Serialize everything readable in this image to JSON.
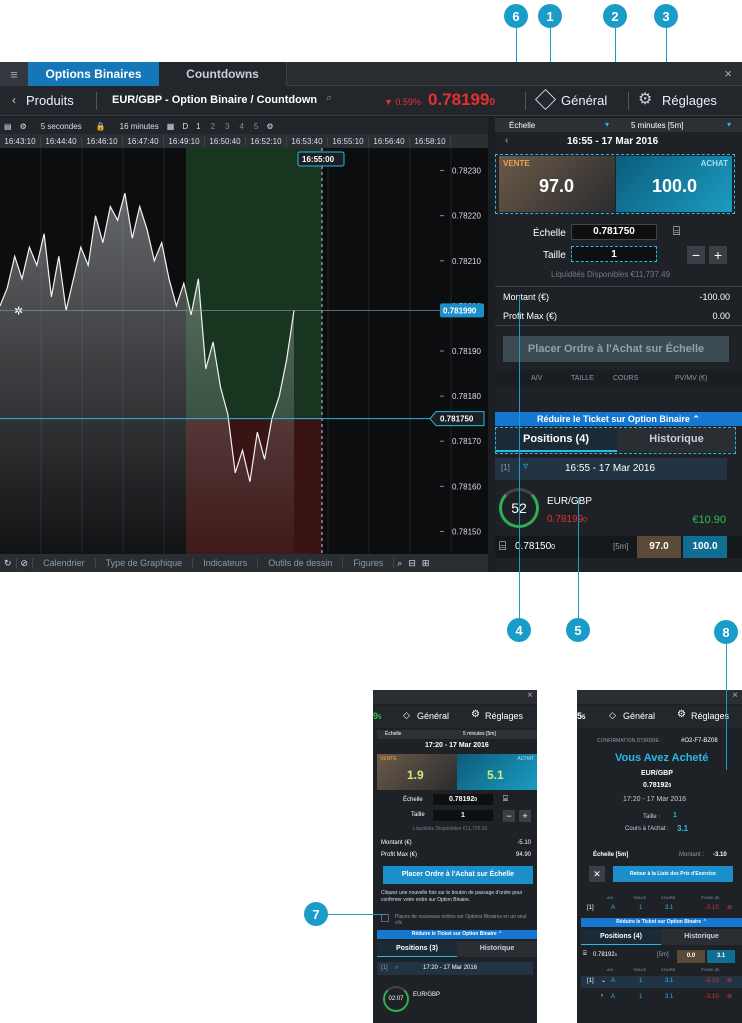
{
  "callouts": [
    "1",
    "2",
    "3",
    "4",
    "5",
    "6",
    "7",
    "8"
  ],
  "menu_tabs": [
    "Options Binaires",
    "Countdowns"
  ],
  "close_glyph": "×",
  "subbar": {
    "back_label": "Produits",
    "instrument": "EUR/GBP - Option Binaire / Countdown",
    "change": "▼ 0.59%",
    "price_main": "0.78199",
    "price_sub": "0",
    "general": "Général",
    "settings": "Réglages"
  },
  "chart_toolbar": {
    "interval": "5 secondes",
    "range": "16 minutes",
    "d": "D",
    "pages": [
      "1",
      "2",
      "3",
      "4",
      "5"
    ]
  },
  "time_ticks": [
    "16:43:10",
    "16:44:40",
    "16:46:10",
    "16:47:40",
    "16:49:10",
    "16:50:40",
    "16:52:10",
    "16:53:40",
    "16:55:10",
    "16:56:40",
    "16:58:10"
  ],
  "chart_data": {
    "type": "line",
    "y_ticks": [
      "0.78230",
      "0.78220",
      "0.78210",
      "0.78200",
      "0.78190",
      "0.78180",
      "0.78170",
      "0.78160",
      "0.78150"
    ],
    "ylim": [
      0.78145,
      0.78235
    ],
    "current_price_label": "0.781990",
    "strike_label": "0.781750",
    "expiry_label": "16:55:00",
    "series": [
      {
        "values": [
          0.782,
          0.78204,
          0.78211,
          0.78206,
          0.78213,
          0.78209,
          0.78216,
          0.78202,
          0.78211,
          0.78199,
          0.78206,
          0.78213,
          0.78209,
          0.7822,
          0.78214,
          0.78222,
          0.78219,
          0.78225,
          0.78215,
          0.78222,
          0.78217,
          0.7821,
          0.78214,
          0.78206,
          0.782,
          0.78205,
          0.78198,
          0.78206,
          0.78186,
          0.78192,
          0.78182,
          0.78176,
          0.78163,
          0.78168,
          0.78161,
          0.78172,
          0.78166,
          0.78175,
          0.7818,
          0.78188,
          0.78199
        ]
      }
    ]
  },
  "bottom_tools": [
    "Calendrier",
    "Type de Graphique",
    "Indicateurs",
    "Outils de dessin",
    "Figures"
  ],
  "ticket": {
    "echelle_label": "Échelle",
    "period": "5 minutes [5m]",
    "expiry": "16:55 - 17 Mar 2016",
    "vente_label": "VENTE",
    "achat_label": "ACHAT",
    "vente_price": "97.0",
    "achat_price": "100.0",
    "echelle_field_label": "Échelle",
    "echelle_value": "0.781750",
    "taille_label": "Taille",
    "taille_value": "1",
    "liquidity": "Liquidités Disponibles €11,737.49",
    "montant_label": "Montant (€)",
    "montant_value": "-100.00",
    "profit_label": "Profit Max (€)",
    "profit_value": "0.00",
    "place_button": "Placer Ordre à l'Achat sur Échelle",
    "cols": [
      "A/V",
      "TAILLE",
      "COURS",
      "PV/MV (€)"
    ],
    "reduce": "Réduire le Ticket sur Option Binaire",
    "positions_tab": "Positions (4)",
    "history_tab": "Historique",
    "pos_index": "[1]",
    "pos_expiry": "16:55 - 17 Mar 2016",
    "countdown": "52",
    "pos_pair": "EUR/GBP",
    "pos_price_main": "0.78199",
    "pos_price_sub": "0",
    "pos_pnl": "€10.90",
    "pos_strike_main": "0.78150",
    "pos_strike_sub": "0",
    "pos_period": "[5m]",
    "pos_sell": "97.0",
    "pos_buy": "100.0"
  },
  "mini1": {
    "top_code": "9",
    "top_sub": "5",
    "general": "Général",
    "settings": "Réglages",
    "echelle": "Échelle",
    "period": "5 minutes [5m]",
    "expiry": "17:20 - 17 Mar 2016",
    "vente_label": "VENTE",
    "achat_label": "ACHAT",
    "vente": "1.9",
    "achat": "5.1",
    "echelle_value_main": "0.78192",
    "echelle_value_sub": "0",
    "taille_label": "Taille",
    "taille": "1",
    "liquidity": "Liquidités Disponibles €11,725.91",
    "montant_label": "Montant (€)",
    "montant": "-5.10",
    "profit_label": "Profit Max (€)",
    "profit": "94.90",
    "place_button": "Placer Ordre à l'Achat sur Échelle",
    "hint": "Cliquez une nouvelle fois sur le bouton de passage d'ordre pour confirmer votre ordre sur Option Binaire.",
    "checkbox_label": "Placez de nouveaux ordres sur Options Binaires en un seul clic",
    "reduce": "Réduire le Ticket sur Option Binaire",
    "positions_tab": "Positions (3)",
    "history_tab": "Historique",
    "pos_index": "[1]",
    "pos_expiry": "17:20 - 17 Mar 2016",
    "countdown": "02:07",
    "pos_pair": "EUR/GBP"
  },
  "mini2": {
    "top_code": "5",
    "top_sub": "5",
    "general": "Général",
    "settings": "Réglages",
    "confirm_label": "CONFIRMATION D'ORDRE :",
    "confirm_code": "#O2-F7-BZ08",
    "bought": "Vous Avez Acheté",
    "pair": "EUR/GBP",
    "price_main": "0.78192",
    "price_sub": "0",
    "expiry": "17:20 - 17 Mar 2016",
    "taille_label": "Taille :",
    "taille": "1",
    "cours_label": "Cours à l'Achat :",
    "cours": "3.1",
    "echelle_label": "Échelle [5m]",
    "montant_label": "Montant :",
    "montant": "-3.10",
    "return_button": "Retour à la Liste des Prix d'Exercice",
    "cols": [
      "A/V",
      "TAILLE",
      "COURS",
      "PV/MV (€)"
    ],
    "row": [
      "[1]",
      "A",
      "1",
      "3.1",
      "-3.10"
    ],
    "reduce": "Réduire le Ticket sur Option Binaire",
    "positions_tab": "Positions (4)",
    "history_tab": "Historique",
    "strike_main": "0.78192",
    "strike_sub": "0",
    "period": "[5m]",
    "sell": "0.0",
    "buy": "3.1",
    "rows": [
      [
        "[1]",
        "A",
        "1",
        "3.1",
        "-3.10"
      ],
      [
        "",
        "A",
        "1",
        "3.1",
        "-3.10"
      ]
    ]
  }
}
